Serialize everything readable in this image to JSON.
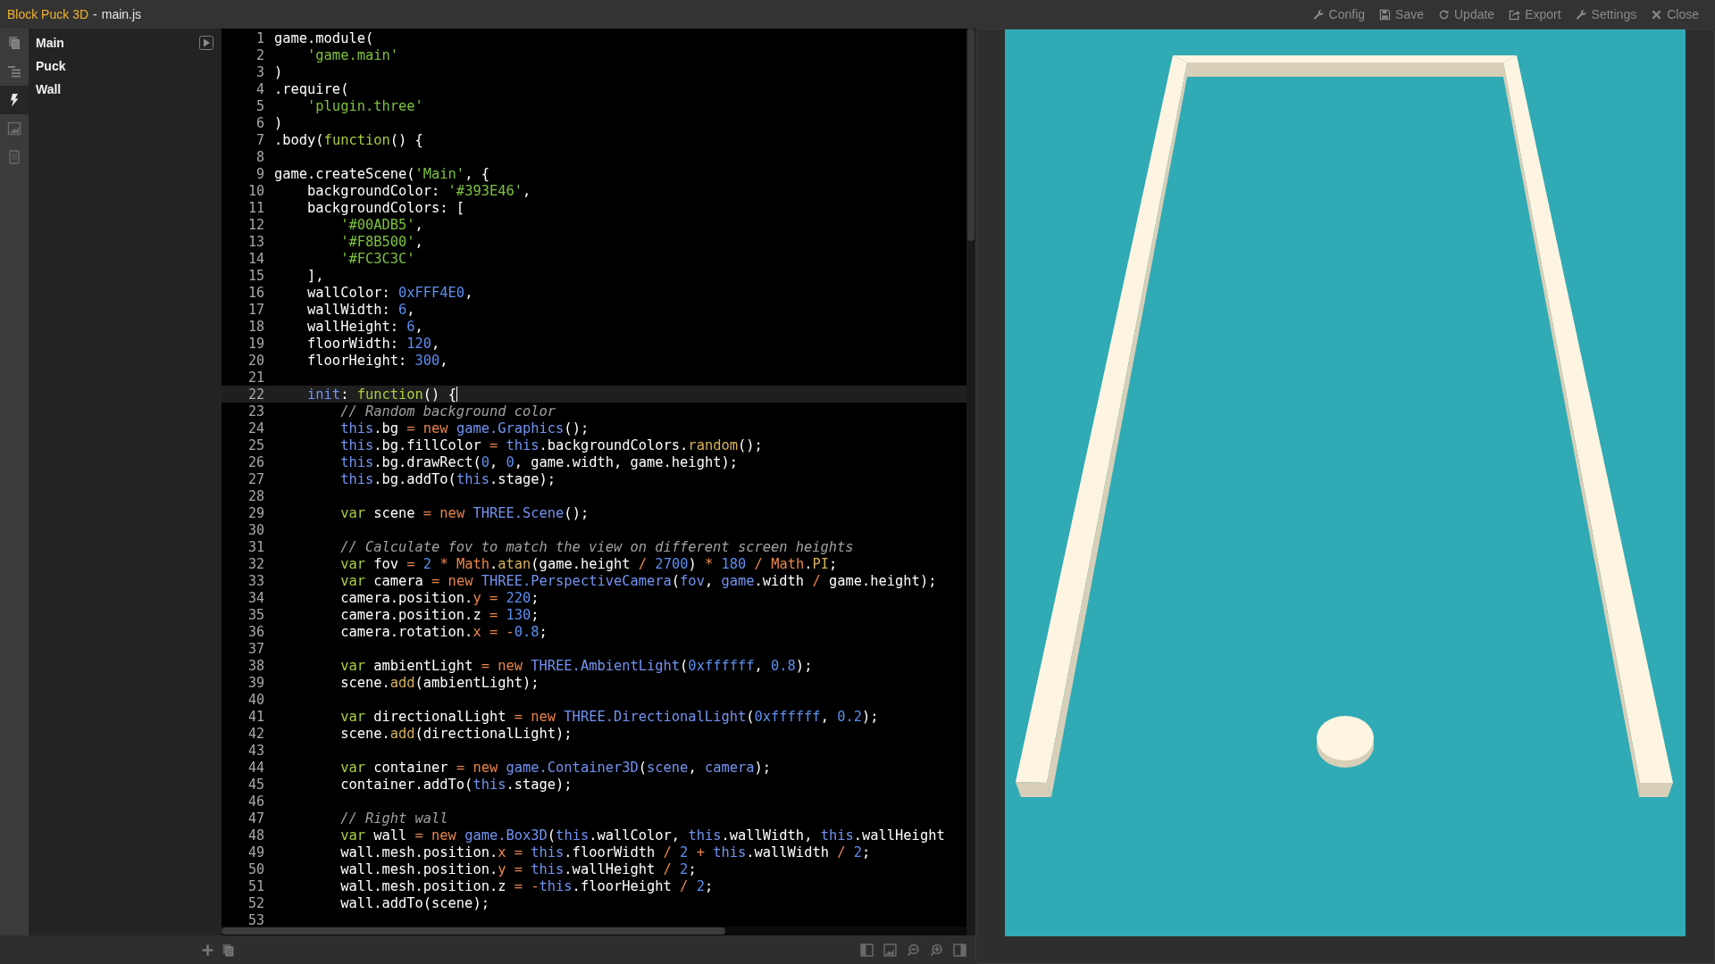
{
  "window": {
    "project": "Block Puck 3D",
    "separator": "-",
    "file": "main.js"
  },
  "toolbar": [
    {
      "label": "Config",
      "kind": "wrench"
    },
    {
      "label": "Save",
      "kind": "floppy"
    },
    {
      "label": "Update",
      "kind": "refresh"
    },
    {
      "label": "Export",
      "kind": "export"
    },
    {
      "label": "Settings",
      "kind": "wrench"
    },
    {
      "label": "Close",
      "kind": "close"
    }
  ],
  "rail": [
    {
      "kind": "files",
      "selected": false
    },
    {
      "kind": "list",
      "selected": false
    },
    {
      "kind": "bolt",
      "selected": true
    },
    {
      "kind": "image",
      "selected": false
    },
    {
      "kind": "tablet",
      "selected": false
    }
  ],
  "scenes": [
    {
      "label": "Main",
      "runnable": true
    },
    {
      "label": "Puck",
      "runnable": false
    },
    {
      "label": "Wall",
      "runnable": false
    }
  ],
  "lines": [
    {
      "n": "1",
      "current": false,
      "tokens": [
        {
          "text": "game.module(",
          "kind": "plain"
        }
      ]
    },
    {
      "n": "2",
      "current": false,
      "tokens": [
        {
          "text": "    'game.main'",
          "kind": "string"
        }
      ]
    },
    {
      "n": "3",
      "current": false,
      "tokens": [
        {
          "text": ")",
          "kind": "plain"
        }
      ]
    },
    {
      "n": "4",
      "current": false,
      "tokens": [
        {
          "text": ".require(",
          "kind": "plain"
        }
      ]
    },
    {
      "n": "5",
      "current": false,
      "tokens": [
        {
          "text": "    'plugin.three'",
          "kind": "string"
        }
      ]
    },
    {
      "n": "6",
      "current": false,
      "tokens": [
        {
          "text": ")",
          "kind": "plain"
        }
      ]
    },
    {
      "n": "7",
      "current": false,
      "tokens": [
        {
          "text": ".body(",
          "kind": "plain"
        },
        {
          "text": "function",
          "kind": "keyword"
        },
        {
          "text": "() {",
          "kind": "plain"
        }
      ]
    },
    {
      "n": "8",
      "current": false
    },
    {
      "n": "9",
      "current": false,
      "tokens": [
        {
          "text": "game.createScene(",
          "kind": "plain"
        },
        {
          "text": "'Main'",
          "kind": "string"
        },
        {
          "text": ", {",
          "kind": "plain"
        }
      ]
    },
    {
      "n": "10",
      "current": false,
      "tokens": [
        {
          "text": "    backgroundColor: ",
          "kind": "plain"
        },
        {
          "text": "'#393E46'",
          "kind": "string"
        },
        {
          "text": ",",
          "kind": "plain"
        }
      ]
    },
    {
      "n": "11",
      "current": false,
      "tokens": [
        {
          "text": "    backgroundColors: [",
          "kind": "plain"
        }
      ]
    },
    {
      "n": "12",
      "current": false,
      "tokens": [
        {
          "text": "        '#00ADB5'",
          "kind": "string"
        },
        {
          "text": ",",
          "kind": "plain"
        }
      ]
    },
    {
      "n": "13",
      "current": false,
      "tokens": [
        {
          "text": "        '#F8B500'",
          "kind": "string"
        },
        {
          "text": ",",
          "kind": "plain"
        }
      ]
    },
    {
      "n": "14",
      "current": false,
      "tokens": [
        {
          "text": "        '#FC3C3C'",
          "kind": "string"
        }
      ]
    },
    {
      "n": "15",
      "current": false,
      "tokens": [
        {
          "text": "    ],",
          "kind": "plain"
        }
      ]
    },
    {
      "n": "16",
      "current": false,
      "tokens": [
        {
          "text": "    wallColor: ",
          "kind": "plain"
        },
        {
          "text": "0xFFF4E0",
          "kind": "number"
        },
        {
          "text": ",",
          "kind": "plain"
        }
      ]
    },
    {
      "n": "17",
      "current": false,
      "tokens": [
        {
          "text": "    wallWidth: ",
          "kind": "plain"
        },
        {
          "text": "6",
          "kind": "number"
        },
        {
          "text": ",",
          "kind": "plain"
        }
      ]
    },
    {
      "n": "18",
      "current": false,
      "tokens": [
        {
          "text": "    wallHeight: ",
          "kind": "plain"
        },
        {
          "text": "6",
          "kind": "number"
        },
        {
          "text": ",",
          "kind": "plain"
        }
      ]
    },
    {
      "n": "19",
      "current": false,
      "tokens": [
        {
          "text": "    floorWidth: ",
          "kind": "plain"
        },
        {
          "text": "120",
          "kind": "number"
        },
        {
          "text": ",",
          "kind": "plain"
        }
      ]
    },
    {
      "n": "20",
      "current": false,
      "tokens": [
        {
          "text": "    floorHeight: ",
          "kind": "plain"
        },
        {
          "text": "300",
          "kind": "number"
        },
        {
          "text": ",",
          "kind": "plain"
        }
      ]
    },
    {
      "n": "21",
      "current": false
    },
    {
      "n": "22",
      "current": true,
      "tokens": [
        {
          "text": "    init",
          "kind": "ident"
        },
        {
          "text": ": ",
          "kind": "plain"
        },
        {
          "text": "function",
          "kind": "keyword"
        },
        {
          "text": "() {",
          "kind": "plain"
        }
      ]
    },
    {
      "n": "23",
      "current": false,
      "tokens": [
        {
          "text": "        // Random background color",
          "kind": "comment"
        }
      ]
    },
    {
      "n": "24",
      "current": false,
      "tokens": [
        {
          "text": "        this",
          "kind": "ident"
        },
        {
          "text": ".bg ",
          "kind": "plain"
        },
        {
          "text": "= new ",
          "kind": "operator"
        },
        {
          "text": "game.Graphics",
          "kind": "ident"
        },
        {
          "text": "();",
          "kind": "plain"
        }
      ]
    },
    {
      "n": "25",
      "current": false,
      "tokens": [
        {
          "text": "        this",
          "kind": "ident"
        },
        {
          "text": ".bg.fillColor ",
          "kind": "plain"
        },
        {
          "text": "= ",
          "kind": "operator"
        },
        {
          "text": "this",
          "kind": "ident"
        },
        {
          "text": ".backgroundColors.",
          "kind": "plain"
        },
        {
          "text": "random",
          "kind": "call"
        },
        {
          "text": "();",
          "kind": "plain"
        }
      ]
    },
    {
      "n": "26",
      "current": false,
      "tokens": [
        {
          "text": "        this",
          "kind": "ident"
        },
        {
          "text": ".bg.drawRect(",
          "kind": "plain"
        },
        {
          "text": "0",
          "kind": "number"
        },
        {
          "text": ", ",
          "kind": "plain"
        },
        {
          "text": "0",
          "kind": "number"
        },
        {
          "text": ", game.width, game.height);",
          "kind": "plain"
        }
      ]
    },
    {
      "n": "27",
      "current": false,
      "tokens": [
        {
          "text": "        this",
          "kind": "ident"
        },
        {
          "text": ".bg.addTo(",
          "kind": "plain"
        },
        {
          "text": "this",
          "kind": "ident"
        },
        {
          "text": ".stage);",
          "kind": "plain"
        }
      ]
    },
    {
      "n": "28",
      "current": false
    },
    {
      "n": "29",
      "current": false,
      "tokens": [
        {
          "text": "        var ",
          "kind": "keyword"
        },
        {
          "text": "scene ",
          "kind": "plain"
        },
        {
          "text": "= new ",
          "kind": "operator"
        },
        {
          "text": "THREE.Scene",
          "kind": "ident"
        },
        {
          "text": "();",
          "kind": "plain"
        }
      ]
    },
    {
      "n": "30",
      "current": false
    },
    {
      "n": "31",
      "current": false,
      "tokens": [
        {
          "text": "        // Calculate fov to match the view on different screen heights",
          "kind": "comment"
        }
      ]
    },
    {
      "n": "32",
      "current": false,
      "tokens": [
        {
          "text": "        var ",
          "kind": "keyword"
        },
        {
          "text": "fov ",
          "kind": "plain"
        },
        {
          "text": "= ",
          "kind": "operator"
        },
        {
          "text": "2 ",
          "kind": "number"
        },
        {
          "text": "* Math",
          "kind": "operator"
        },
        {
          "text": ".",
          "kind": "plain"
        },
        {
          "text": "atan",
          "kind": "call"
        },
        {
          "text": "(game.height ",
          "kind": "plain"
        },
        {
          "text": "/ ",
          "kind": "operator"
        },
        {
          "text": "2700",
          "kind": "number"
        },
        {
          "text": ") ",
          "kind": "plain"
        },
        {
          "text": "* ",
          "kind": "operator"
        },
        {
          "text": "180 ",
          "kind": "number"
        },
        {
          "text": "/ Math",
          "kind": "operator"
        },
        {
          "text": ".",
          "kind": "plain"
        },
        {
          "text": "PI",
          "kind": "call"
        },
        {
          "text": ";",
          "kind": "plain"
        }
      ]
    },
    {
      "n": "33",
      "current": false,
      "tokens": [
        {
          "text": "        var ",
          "kind": "keyword"
        },
        {
          "text": "camera ",
          "kind": "plain"
        },
        {
          "text": "= new ",
          "kind": "operator"
        },
        {
          "text": "THREE.PerspectiveCamera",
          "kind": "ident"
        },
        {
          "text": "(",
          "kind": "plain"
        },
        {
          "text": "fov",
          "kind": "ident"
        },
        {
          "text": ", ",
          "kind": "plain"
        },
        {
          "text": "game",
          "kind": "ident"
        },
        {
          "text": ".width ",
          "kind": "plain"
        },
        {
          "text": "/ ",
          "kind": "operator"
        },
        {
          "text": "game.height);",
          "kind": "plain"
        }
      ]
    },
    {
      "n": "34",
      "current": false,
      "tokens": [
        {
          "text": "        camera.position.",
          "kind": "plain"
        },
        {
          "text": "y = ",
          "kind": "operator"
        },
        {
          "text": "220",
          "kind": "number"
        },
        {
          "text": ";",
          "kind": "plain"
        }
      ]
    },
    {
      "n": "35",
      "current": false,
      "tokens": [
        {
          "text": "        camera.position.z ",
          "kind": "plain"
        },
        {
          "text": "= ",
          "kind": "operator"
        },
        {
          "text": "130",
          "kind": "number"
        },
        {
          "text": ";",
          "kind": "plain"
        }
      ]
    },
    {
      "n": "36",
      "current": false,
      "tokens": [
        {
          "text": "        camera.rotation.",
          "kind": "plain"
        },
        {
          "text": "x = -",
          "kind": "operator"
        },
        {
          "text": "0.8",
          "kind": "number"
        },
        {
          "text": ";",
          "kind": "plain"
        }
      ]
    },
    {
      "n": "37",
      "current": false
    },
    {
      "n": "38",
      "current": false,
      "tokens": [
        {
          "text": "        var ",
          "kind": "keyword"
        },
        {
          "text": "ambientLight ",
          "kind": "plain"
        },
        {
          "text": "= new ",
          "kind": "operator"
        },
        {
          "text": "THREE.AmbientLight",
          "kind": "ident"
        },
        {
          "text": "(",
          "kind": "plain"
        },
        {
          "text": "0xffffff",
          "kind": "number"
        },
        {
          "text": ", ",
          "kind": "plain"
        },
        {
          "text": "0.8",
          "kind": "number"
        },
        {
          "text": ");",
          "kind": "plain"
        }
      ]
    },
    {
      "n": "39",
      "current": false,
      "tokens": [
        {
          "text": "        scene.",
          "kind": "plain"
        },
        {
          "text": "add",
          "kind": "call"
        },
        {
          "text": "(ambientLight);",
          "kind": "plain"
        }
      ]
    },
    {
      "n": "40",
      "current": false
    },
    {
      "n": "41",
      "current": false,
      "tokens": [
        {
          "text": "        var ",
          "kind": "keyword"
        },
        {
          "text": "directionalLight ",
          "kind": "plain"
        },
        {
          "text": "= new ",
          "kind": "operator"
        },
        {
          "text": "THREE.DirectionalLight",
          "kind": "ident"
        },
        {
          "text": "(",
          "kind": "plain"
        },
        {
          "text": "0xffffff",
          "kind": "number"
        },
        {
          "text": ", ",
          "kind": "plain"
        },
        {
          "text": "0.2",
          "kind": "number"
        },
        {
          "text": ");",
          "kind": "plain"
        }
      ]
    },
    {
      "n": "42",
      "current": false,
      "tokens": [
        {
          "text": "        scene.",
          "kind": "plain"
        },
        {
          "text": "add",
          "kind": "call"
        },
        {
          "text": "(directionalLight);",
          "kind": "plain"
        }
      ]
    },
    {
      "n": "43",
      "current": false
    },
    {
      "n": "44",
      "current": false,
      "tokens": [
        {
          "text": "        var ",
          "kind": "keyword"
        },
        {
          "text": "container ",
          "kind": "plain"
        },
        {
          "text": "= new ",
          "kind": "operator"
        },
        {
          "text": "game.Container3D",
          "kind": "ident"
        },
        {
          "text": "(",
          "kind": "plain"
        },
        {
          "text": "scene",
          "kind": "ident"
        },
        {
          "text": ", ",
          "kind": "plain"
        },
        {
          "text": "camera",
          "kind": "ident"
        },
        {
          "text": ");",
          "kind": "plain"
        }
      ]
    },
    {
      "n": "45",
      "current": false,
      "tokens": [
        {
          "text": "        container.addTo(",
          "kind": "plain"
        },
        {
          "text": "this",
          "kind": "ident"
        },
        {
          "text": ".stage);",
          "kind": "plain"
        }
      ]
    },
    {
      "n": "46",
      "current": false
    },
    {
      "n": "47",
      "current": false,
      "tokens": [
        {
          "text": "        // Right wall",
          "kind": "comment"
        }
      ]
    },
    {
      "n": "48",
      "current": false,
      "tokens": [
        {
          "text": "        var ",
          "kind": "keyword"
        },
        {
          "text": "wall ",
          "kind": "plain"
        },
        {
          "text": "= new ",
          "kind": "operator"
        },
        {
          "text": "game.Box3D",
          "kind": "ident"
        },
        {
          "text": "(",
          "kind": "plain"
        },
        {
          "text": "this",
          "kind": "ident"
        },
        {
          "text": ".wallColor, ",
          "kind": "plain"
        },
        {
          "text": "this",
          "kind": "ident"
        },
        {
          "text": ".wallWidth, ",
          "kind": "plain"
        },
        {
          "text": "this",
          "kind": "ident"
        },
        {
          "text": ".wallHeight",
          "kind": "plain"
        }
      ]
    },
    {
      "n": "49",
      "current": false,
      "tokens": [
        {
          "text": "        wall.mesh.position.",
          "kind": "plain"
        },
        {
          "text": "x = ",
          "kind": "operator"
        },
        {
          "text": "this",
          "kind": "ident"
        },
        {
          "text": ".floorWidth ",
          "kind": "plain"
        },
        {
          "text": "/ ",
          "kind": "operator"
        },
        {
          "text": "2 ",
          "kind": "number"
        },
        {
          "text": "+ ",
          "kind": "operator"
        },
        {
          "text": "this",
          "kind": "ident"
        },
        {
          "text": ".wallWidth ",
          "kind": "plain"
        },
        {
          "text": "/ ",
          "kind": "operator"
        },
        {
          "text": "2",
          "kind": "number"
        },
        {
          "text": ";",
          "kind": "plain"
        }
      ]
    },
    {
      "n": "50",
      "current": false,
      "tokens": [
        {
          "text": "        wall.mesh.position.",
          "kind": "plain"
        },
        {
          "text": "y = ",
          "kind": "operator"
        },
        {
          "text": "this",
          "kind": "ident"
        },
        {
          "text": ".wallHeight ",
          "kind": "plain"
        },
        {
          "text": "/ ",
          "kind": "operator"
        },
        {
          "text": "2",
          "kind": "number"
        },
        {
          "text": ";",
          "kind": "plain"
        }
      ]
    },
    {
      "n": "51",
      "current": false,
      "tokens": [
        {
          "text": "        wall.mesh.position.z ",
          "kind": "plain"
        },
        {
          "text": "= -",
          "kind": "operator"
        },
        {
          "text": "this",
          "kind": "ident"
        },
        {
          "text": ".floorHeight ",
          "kind": "plain"
        },
        {
          "text": "/ ",
          "kind": "operator"
        },
        {
          "text": "2",
          "kind": "number"
        },
        {
          "text": ";",
          "kind": "plain"
        }
      ]
    },
    {
      "n": "52",
      "current": false,
      "tokens": [
        {
          "text": "        wall.addTo(scene);",
          "kind": "plain"
        }
      ]
    },
    {
      "n": "53",
      "current": false
    }
  ]
}
